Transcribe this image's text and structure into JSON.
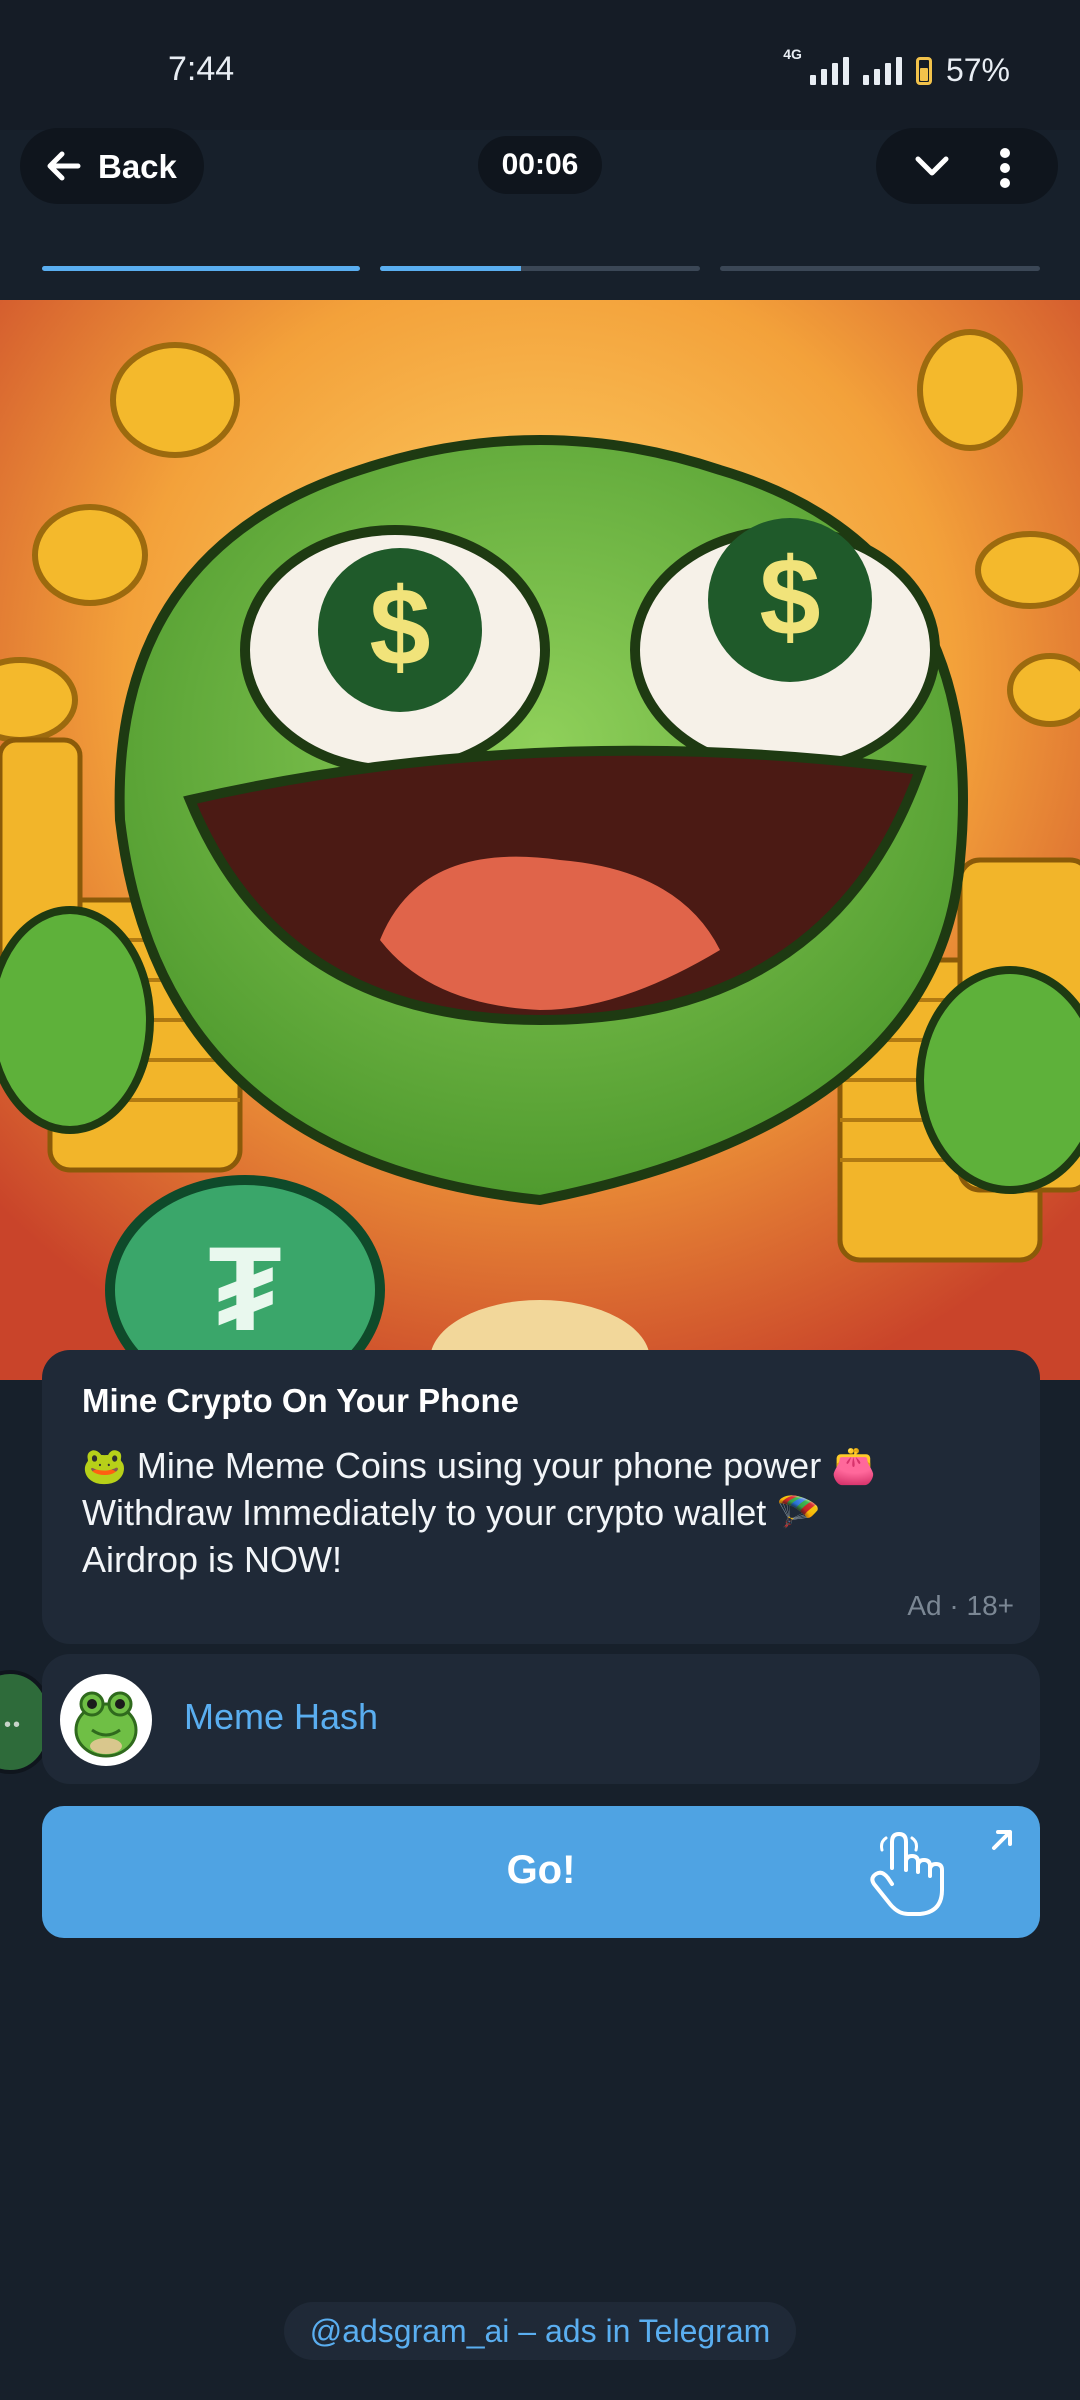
{
  "status_bar": {
    "time": "7:44",
    "network": "4G",
    "battery": "57%"
  },
  "header": {
    "back_label": "Back",
    "timer": "00:06",
    "progress": [
      1.0,
      0.44,
      0.0
    ]
  },
  "ad_image": {
    "alt": "Cartoon frog with dollar-sign eyes surrounded by gold coins"
  },
  "card": {
    "title": "Mine Crypto On Your Phone",
    "line1": "🐸 Mine Meme Coins using your phone power 👛",
    "line2": "Withdraw Immediately to your crypto wallet 🪂",
    "line3": "Airdrop is NOW!",
    "meta": "Ad · 18+"
  },
  "channel": {
    "name": "Meme Hash"
  },
  "cta": {
    "label": "Go!"
  },
  "footer": {
    "text": "@adsgram_ai – ads in Telegram"
  },
  "colors": {
    "background": "#17202b",
    "card": "#1f2937",
    "accent": "#4fa3e3",
    "link": "#5aaef0"
  },
  "icons": [
    "back-arrow-icon",
    "chevron-down-icon",
    "more-vert-icon",
    "tap-hand-icon",
    "external-link-icon"
  ]
}
